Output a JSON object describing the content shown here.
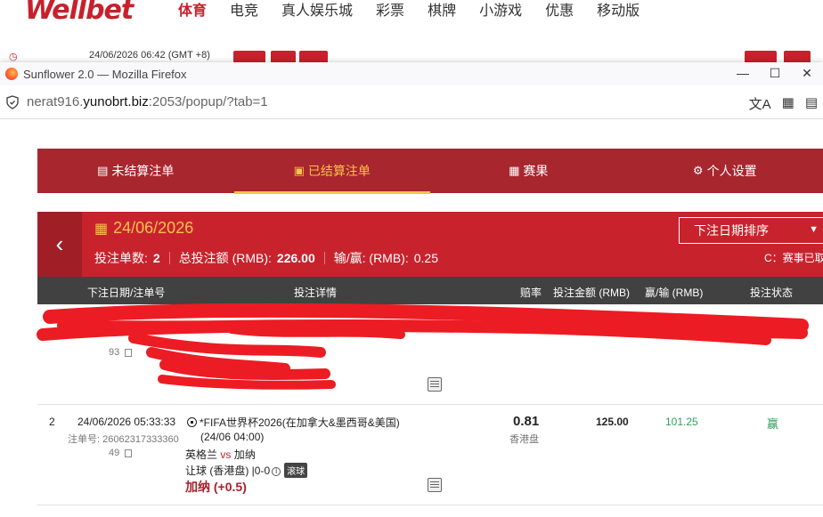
{
  "bg_site": {
    "logo": "Wellbet",
    "menu": [
      "体育",
      "电竞",
      "真人娱乐城",
      "彩票",
      "棋牌",
      "小游戏",
      "优惠",
      "移动版"
    ],
    "active_menu": "体育",
    "clock": "24/06/2026 06:42 (GMT +8)"
  },
  "window": {
    "title": "Sunflower 2.0 — Mozilla Firefox",
    "url_prefix": "nerat916.",
    "url_host": "yunobrt.biz",
    "url_suffix": ":2053/popup/?tab=1"
  },
  "tabs": [
    {
      "label": "未结算注单",
      "icon": "ticket-icon"
    },
    {
      "label": "已结算注单",
      "icon": "settled-ticket-icon",
      "active": true
    },
    {
      "label": "赛果",
      "icon": "scoreboard-icon"
    },
    {
      "label": "个人设置",
      "icon": "gear-icon"
    }
  ],
  "summary": {
    "date": "24/06/2026",
    "count_label": "投注单数:",
    "count": "2",
    "total_label": "总投注额 (RMB):",
    "total": "226.00",
    "winloss_label": "输/赢: (RMB):",
    "winloss": "0.25",
    "sort_label": "下注日期排序",
    "hint": "C：赛事已取"
  },
  "columns": [
    "下注日期/注单号",
    "投注详情",
    "赔率",
    "投注金额 (RMB)",
    "赢/输 (RMB)",
    "投注状态"
  ],
  "rows": [
    {
      "index": "2",
      "datetime": "24/06/2026 05:33:33",
      "order_label": "注单号:",
      "order_no": "26062317333360",
      "order_no_tail": "49",
      "event": "*FIFA世界杯2026(在加拿大&墨西哥&美国)",
      "event_time": "(24/06 04:00)",
      "home": "英格兰",
      "vs": "vs",
      "away": "加纳",
      "market": "让球 (香港盘)",
      "score": "0-0",
      "live_tag": "滚球",
      "selection": "加纳 (+0.5)",
      "odds": "0.81",
      "odds_type": "香港盘",
      "stake": "125.00",
      "winloss": "101.25",
      "status": "赢"
    }
  ],
  "colors": {
    "brand_red": "#c8232d",
    "tab_bar": "#a8262e",
    "accent_gold": "#f9c24d",
    "win_green": "#2f9e5c"
  }
}
